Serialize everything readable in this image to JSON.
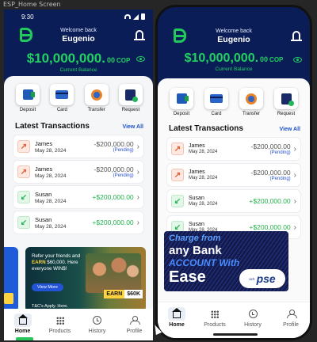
{
  "window": {
    "title": "ESP_Home Screen"
  },
  "left_phone": {
    "status": {
      "time": "9:30"
    },
    "header": {
      "welcome": "Welcome back",
      "username": "Eugenio"
    },
    "balance": {
      "main": "$10,000,000.",
      "decimals": "00",
      "currency": "COP",
      "label": "Current Balance"
    },
    "actions": [
      {
        "label": "Deposit",
        "icon": "deposit-icon"
      },
      {
        "label": "Card",
        "icon": "card-icon"
      },
      {
        "label": "Transfer",
        "icon": "transfer-icon"
      },
      {
        "label": "Request",
        "icon": "request-icon"
      }
    ],
    "transactions_title": "Latest Transactions",
    "view_all": "View All",
    "transactions": [
      {
        "name": "James",
        "date": "May 28, 2024",
        "amount": "-$200,000.00",
        "status": "(Pending)",
        "type": "out"
      },
      {
        "name": "James",
        "date": "May 28, 2024",
        "amount": "-$200,000.00",
        "status": "(Pending)",
        "type": "out"
      },
      {
        "name": "Susan",
        "date": "May 28, 2024",
        "amount": "+$200,000.00",
        "status": "",
        "type": "in"
      },
      {
        "name": "Susan",
        "date": "May 28, 2024",
        "amount": "+$200,000.00",
        "status": "",
        "type": "in"
      }
    ],
    "promo": {
      "line_a": "Refer your friends and ",
      "earn_word": "EARN",
      "line_b": " $60,000. Here everyone WIN$!",
      "button": "View More",
      "tc": "T&C's Apply. Here.",
      "badge_earn": "EARN",
      "badge_amount": "$60K"
    },
    "nav": [
      {
        "label": "Home",
        "icon": "home-icon",
        "active": true
      },
      {
        "label": "Products",
        "icon": "grid-icon",
        "active": false
      },
      {
        "label": "History",
        "icon": "history-icon",
        "active": false
      },
      {
        "label": "Profile",
        "icon": "profile-icon",
        "active": false
      }
    ]
  },
  "right_phone": {
    "header": {
      "welcome": "Welcome back",
      "username": "Eugenio"
    },
    "balance": {
      "main": "$10,000,000.",
      "decimals": "00",
      "currency": "COP",
      "label": "Current Balance"
    },
    "actions": [
      {
        "label": "Deposit",
        "icon": "deposit-icon"
      },
      {
        "label": "Card",
        "icon": "card-icon"
      },
      {
        "label": "Transfer",
        "icon": "transfer-icon"
      },
      {
        "label": "Request",
        "icon": "request-icon"
      }
    ],
    "transactions_title": "Latest Transactions",
    "view_all": "View All",
    "transactions": [
      {
        "name": "James",
        "date": "May 28, 2024",
        "amount": "-$200,000.00",
        "status": "(Pending)",
        "type": "out"
      },
      {
        "name": "James",
        "date": "May 28, 2024",
        "amount": "-$200,000.00",
        "status": "(Pending)",
        "type": "out"
      },
      {
        "name": "Susan",
        "date": "May 28, 2024",
        "amount": "+$200,000.00",
        "status": "",
        "type": "in"
      },
      {
        "name": "Susan",
        "date": "May 28, 2024",
        "amount": "+$200,000.00",
        "status": "",
        "type": "in"
      }
    ],
    "banner": {
      "line1": "Charge from",
      "line2": "any Bank",
      "line3": "ACCOUNT With",
      "line4": "Ease",
      "logo_small": "ach",
      "logo_word": "pse"
    },
    "nav": [
      {
        "label": "Home",
        "icon": "home-icon",
        "active": true
      },
      {
        "label": "Products",
        "icon": "grid-icon",
        "active": false
      },
      {
        "label": "History",
        "icon": "history-icon",
        "active": false
      },
      {
        "label": "Profile",
        "icon": "profile-icon",
        "active": false
      }
    ]
  },
  "colors": {
    "header_bg": "#0b1d57",
    "accent_green": "#20d060",
    "link_blue": "#1f52c8",
    "negative_text": "#555555",
    "positive_text": "#22b34b"
  }
}
